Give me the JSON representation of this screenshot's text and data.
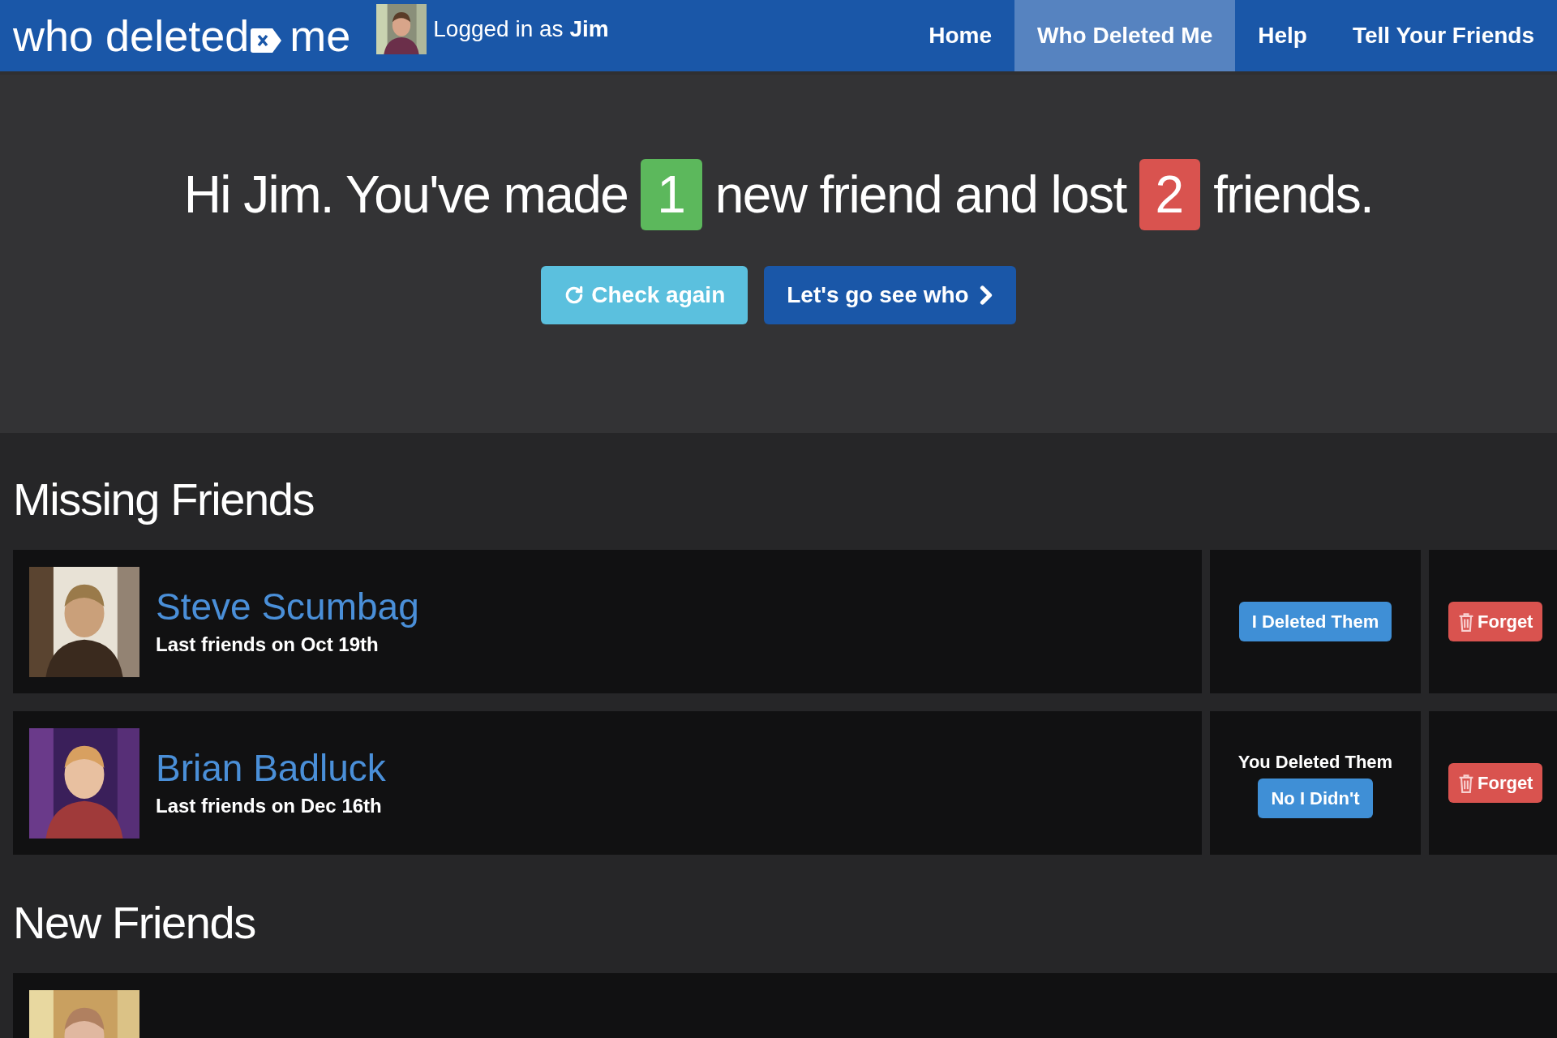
{
  "header": {
    "logo": {
      "before": "who deleted",
      "after": "me"
    },
    "user": {
      "prefix": "Logged in as",
      "name": "Jim"
    },
    "nav": [
      {
        "label": "Home",
        "selected": false
      },
      {
        "label": "Who Deleted Me",
        "selected": true
      },
      {
        "label": "Help",
        "selected": false
      },
      {
        "label": "Tell Your Friends",
        "selected": false
      }
    ]
  },
  "hero": {
    "segments": [
      {
        "kind": "text",
        "text": "Hi Jim. You've made"
      },
      {
        "kind": "badge",
        "text": "1",
        "color": "#5cb85c"
      },
      {
        "kind": "text",
        "text": "new friend and lost"
      },
      {
        "kind": "badge",
        "text": "2",
        "color": "#d9534f"
      },
      {
        "kind": "text",
        "text": "friends."
      }
    ],
    "buttons": [
      {
        "kind": "refresh",
        "label": "Check again"
      },
      {
        "kind": "forward",
        "label": "Let's go see who"
      }
    ]
  },
  "sections": [
    {
      "title": "Missing Friends",
      "friends": [
        {
          "name": "Steve Scumbag",
          "last": "Last friends on Oct 19th",
          "status": {
            "kind": "ask",
            "button": "I Deleted Them"
          },
          "forget": "Forget"
        },
        {
          "name": "Brian Badluck",
          "last": "Last friends on Dec 16th",
          "status": {
            "kind": "deleted",
            "note": "You Deleted Them",
            "button": "No I Didn't"
          },
          "forget": "Forget"
        }
      ]
    },
    {
      "title": "New Friends"
    }
  ]
}
